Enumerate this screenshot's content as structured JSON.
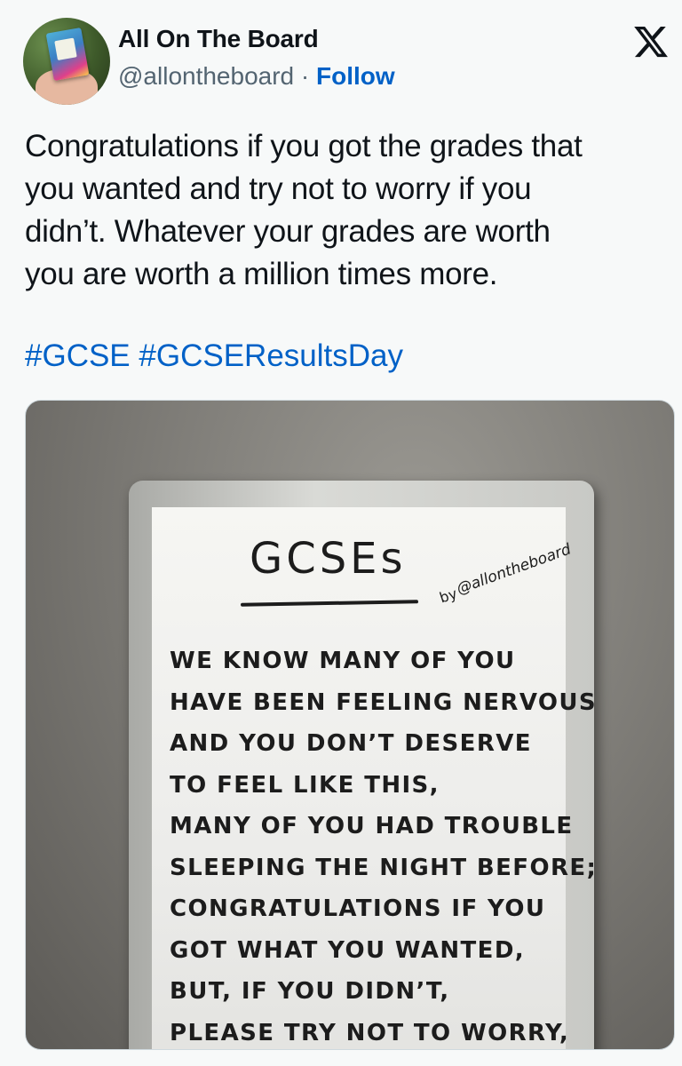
{
  "author": {
    "name": "All On The Board",
    "handle": "@allontheboard",
    "separator": "·",
    "follow_label": "Follow",
    "avatar_icon": "book-cover-avatar"
  },
  "x_logo": {
    "icon": "x-logo-icon",
    "color": "#0f1419"
  },
  "tweet": {
    "lines": [
      "Congratulations if you got the grades that",
      "you wanted and try not to worry if you",
      "didn’t. Whatever your grades are worth",
      "you are worth a million times more."
    ],
    "hashtags": [
      "#GCSE",
      "#GCSEResultsDay"
    ]
  },
  "media": {
    "board_title": "GCSEs",
    "board_by": "by",
    "board_handle": "@allontheboard",
    "board_lines": [
      "WE KNOW MANY OF YOU",
      "HAVE BEEN FEELING NERVOUS",
      "AND YOU DON’T DESERVE",
      "TO FEEL LIKE THIS,",
      "MANY OF YOU HAD TROUBLE",
      "SLEEPING THE NIGHT BEFORE;",
      "CONGRATULATIONS IF YOU",
      "GOT WHAT YOU WANTED,",
      "BUT, IF YOU DIDN’T,",
      "PLEASE TRY NOT TO WORRY,"
    ]
  },
  "colors": {
    "link": "#0061c7",
    "text": "#0f1419",
    "muted": "#536471",
    "background": "#f7f9f9"
  }
}
